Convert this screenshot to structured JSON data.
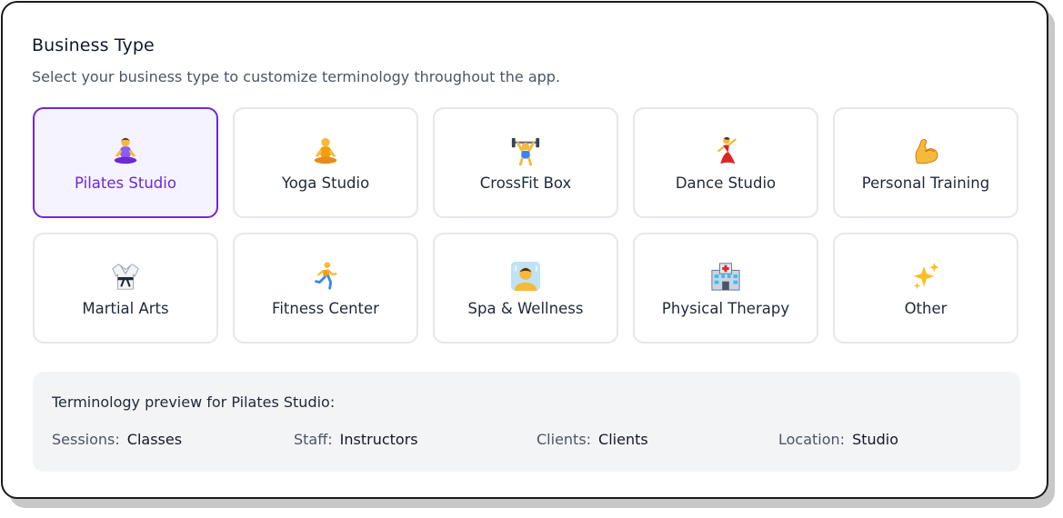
{
  "header": {
    "title": "Business Type",
    "subtitle": "Select your business type to customize terminology throughout the app."
  },
  "business_types": [
    {
      "label": "Pilates Studio",
      "icon": "woman-lotus-position-icon",
      "selected": true
    },
    {
      "label": "Yoga Studio",
      "icon": "person-lotus-position-icon",
      "selected": false
    },
    {
      "label": "CrossFit Box",
      "icon": "weightlifter-icon",
      "selected": false
    },
    {
      "label": "Dance Studio",
      "icon": "woman-dancing-icon",
      "selected": false
    },
    {
      "label": "Personal Training",
      "icon": "flexed-biceps-icon",
      "selected": false
    },
    {
      "label": "Martial Arts",
      "icon": "martial-arts-uniform-icon",
      "selected": false
    },
    {
      "label": "Fitness Center",
      "icon": "person-running-icon",
      "selected": false
    },
    {
      "label": "Spa & Wellness",
      "icon": "person-in-steamy-room-icon",
      "selected": false
    },
    {
      "label": "Physical Therapy",
      "icon": "hospital-icon",
      "selected": false
    },
    {
      "label": "Other",
      "icon": "sparkles-icon",
      "selected": false
    }
  ],
  "preview": {
    "title": "Terminology preview for Pilates Studio:",
    "terms": [
      {
        "key": "Sessions:",
        "value": "Classes"
      },
      {
        "key": "Staff:",
        "value": "Instructors"
      },
      {
        "key": "Clients:",
        "value": "Clients"
      },
      {
        "key": "Location:",
        "value": "Studio"
      }
    ]
  },
  "colors": {
    "accent": "#6d28d9",
    "selected_bg": "#f5f3ff",
    "card_border": "#e5e7eb",
    "preview_bg": "#f3f4f6"
  }
}
